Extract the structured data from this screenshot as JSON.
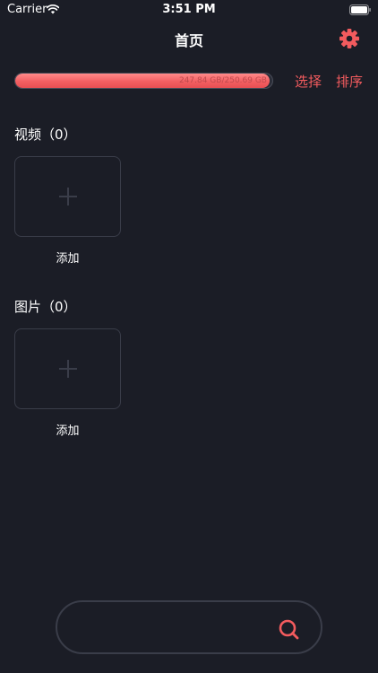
{
  "status_bar": {
    "carrier": "Carrier",
    "time": "3:51 PM",
    "wifi_icon": "wifi-icon",
    "battery_icon": "battery-icon"
  },
  "nav": {
    "title": "首页",
    "settings_icon": "gear-icon"
  },
  "storage": {
    "text": "247.84 GB/250.69 GB",
    "used_fraction": 0.989
  },
  "actions": {
    "select_label": "选择",
    "sort_label": "排序"
  },
  "sections": [
    {
      "heading": "视频（0）",
      "add_label": "添加",
      "add_icon": "plus-icon"
    },
    {
      "heading": "图片（0）",
      "add_label": "添加",
      "add_icon": "plus-icon"
    }
  ],
  "search": {
    "icon": "search-icon"
  },
  "colors": {
    "background": "#1b1d26",
    "accent": "#f25b5e",
    "tile_border": "#3a3d49"
  }
}
